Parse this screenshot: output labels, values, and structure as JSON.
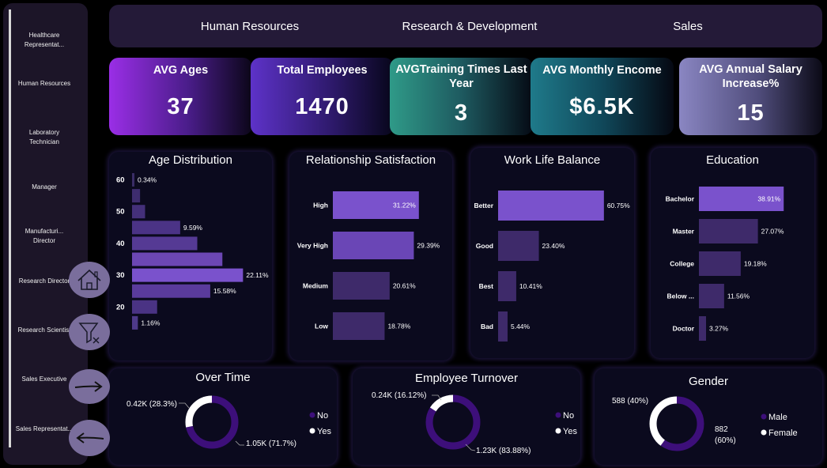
{
  "slicer": {
    "items": [
      "Healthcare Representat...",
      "Human Resources",
      "Laboratory Technician",
      "Manager",
      "Manufacturi... Director",
      "Research Director",
      "Research Scientist",
      "Sales Executive",
      "Sales Representat..."
    ]
  },
  "departments": [
    "Human Resources",
    "Research & Development",
    "Sales"
  ],
  "kpis": [
    {
      "title": "AVG Ages",
      "value": "37"
    },
    {
      "title": "Total Employees",
      "value": "1470"
    },
    {
      "title": "AVGTraining Times Last Year",
      "value": "3"
    },
    {
      "title": "AVG Monthly Encome",
      "value": "$6.5K"
    },
    {
      "title": "AVG Annual Salary Increase%",
      "value": "15"
    }
  ],
  "colors": {
    "accent": "#7a52cc",
    "bar_dark": "#3e2a6a",
    "donut_main": "#3d0f7a",
    "donut_minor": "#ffffff",
    "card_bg": "#0b0a1e"
  },
  "nav_buttons": [
    "home-icon",
    "clear-filter-icon",
    "forward-arrow-icon",
    "back-arrow-icon"
  ],
  "chart_data": [
    {
      "id": "age",
      "type": "bar",
      "orientation": "horizontal",
      "title": "Age Distribution",
      "y_ticks": [
        "60",
        "50",
        "40",
        "30",
        "20"
      ],
      "bin_values": [
        0.34,
        1.6,
        2.6,
        9.59,
        13.0,
        18.0,
        22.11,
        15.58,
        5.0,
        1.16
      ],
      "data_labels": [
        "0.34%",
        "",
        "",
        "9.59%",
        "",
        "",
        "22.11%",
        "15.58%",
        "",
        "1.16%"
      ],
      "xlim": [
        0,
        23
      ]
    },
    {
      "id": "rel",
      "type": "bar",
      "orientation": "horizontal",
      "title": "Relationship Satisfaction",
      "categories": [
        "High",
        "Very High",
        "Medium",
        "Low"
      ],
      "values": [
        31.22,
        29.39,
        20.61,
        18.78
      ],
      "labels": [
        "31.22%",
        "29.39%",
        "20.61%",
        "18.78%"
      ],
      "xlim": [
        0,
        33
      ]
    },
    {
      "id": "wlb",
      "type": "bar",
      "orientation": "horizontal",
      "title": "Work Life Balance",
      "categories": [
        "Better",
        "Good",
        "Best",
        "Bad"
      ],
      "values": [
        60.75,
        23.4,
        10.41,
        5.44
      ],
      "labels": [
        "60.75%",
        "23.40%",
        "10.41%",
        "5.44%"
      ],
      "xlim": [
        0,
        64
      ]
    },
    {
      "id": "edu",
      "type": "bar",
      "orientation": "horizontal",
      "title": "Education",
      "categories": [
        "Bachelor",
        "Master",
        "College",
        "Below ...",
        "Doctor"
      ],
      "values": [
        38.91,
        27.07,
        19.18,
        11.56,
        3.27
      ],
      "labels": [
        "38.91%",
        "27.07%",
        "19.18%",
        "11.56%",
        "3.27%"
      ],
      "xlim": [
        0,
        41
      ]
    },
    {
      "id": "ot",
      "type": "pie",
      "title": "Over Time",
      "categories": [
        "No",
        "Yes"
      ],
      "values": [
        71.7,
        28.3
      ],
      "labels": [
        "1.05K (71.7%)",
        "0.42K (28.3%)"
      ]
    },
    {
      "id": "turn",
      "type": "pie",
      "title": "Employee Turnover",
      "categories": [
        "No",
        "Yes"
      ],
      "values": [
        83.88,
        16.12
      ],
      "labels": [
        "1.23K (83.88%)",
        "0.24K (16.12%)"
      ]
    },
    {
      "id": "gender",
      "type": "pie",
      "title": "Gender",
      "categories": [
        "Male",
        "Female"
      ],
      "values": [
        60,
        40
      ],
      "labels": [
        "882",
        "(60%)",
        "588 (40%)"
      ]
    }
  ]
}
